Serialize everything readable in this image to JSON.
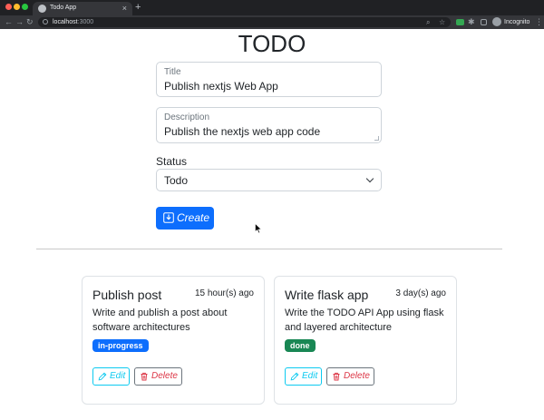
{
  "browser": {
    "tab_title": "Todo App",
    "tab_close": "×",
    "new_tab": "+",
    "url_host": "localhost",
    "url_port": ":3000",
    "incognito_label": "Incognito",
    "nav_back": "←",
    "nav_forward": "→",
    "nav_reload": "↻",
    "menu": "⋮"
  },
  "page": {
    "title": "TODO"
  },
  "form": {
    "title_label": "Title",
    "title_value": "Publish nextjs Web App",
    "description_label": "Description",
    "description_value": "Publish the nextjs web app code",
    "status_label": "Status",
    "status_value": "Todo",
    "create_label": "Create"
  },
  "todos": [
    {
      "title": "Publish post",
      "time": "15 hour(s) ago",
      "description": "Write and publish a post about software architectures",
      "status": "in-progress",
      "edit_label": "Edit",
      "delete_label": "Delete"
    },
    {
      "title": "Write flask app",
      "time": "3 day(s) ago",
      "description": "Write the TODO API App using flask and layered architecture",
      "status": "done",
      "edit_label": "Edit",
      "delete_label": "Delete"
    }
  ],
  "colors": {
    "primary": "#0d6efd",
    "success": "#198754",
    "info": "#0dcaf0",
    "danger": "#dc3545",
    "secondary": "#6c757d"
  }
}
